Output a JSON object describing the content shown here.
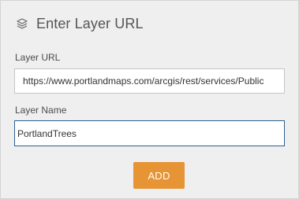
{
  "dialog": {
    "title": "Enter Layer URL",
    "header_icon": "layers-icon"
  },
  "form": {
    "layer_url_label": "Layer URL",
    "layer_url_value": "https://www.portlandmaps.com/arcgis/rest/services/Public",
    "layer_name_label": "Layer Name",
    "layer_name_value": "PortlandTrees"
  },
  "actions": {
    "add_label": "ADD"
  },
  "colors": {
    "panel_background": "#efefef",
    "add_button": "#e69434",
    "focused_border": "#2d5e91"
  }
}
